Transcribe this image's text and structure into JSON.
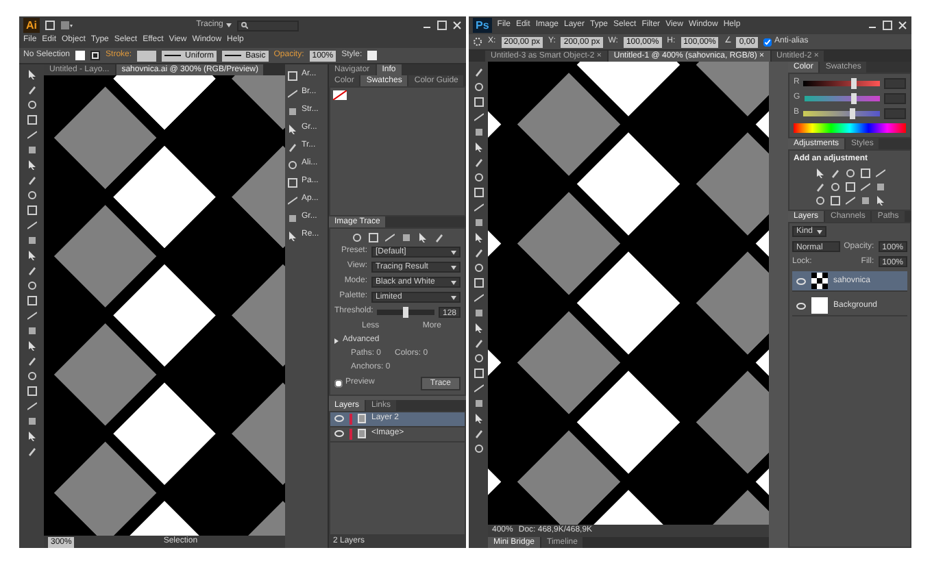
{
  "illustrator": {
    "logo": "Ai",
    "workspace": "Tracing",
    "menu": [
      "File",
      "Edit",
      "Object",
      "Type",
      "Select",
      "Effect",
      "View",
      "Window",
      "Help"
    ],
    "control_bar": {
      "selection": "No Selection",
      "stroke_label": "Stroke:",
      "stroke_profile": "Uniform",
      "brush": "Basic",
      "opacity_label": "Opacity:",
      "opacity": "100%",
      "style_label": "Style:"
    },
    "tabs": [
      {
        "label": "Untitled - Layo...",
        "selected": false
      },
      {
        "label": "sahovnica.ai @ 300% (RGB/Preview)",
        "selected": true
      }
    ],
    "dock": [
      "Ar...",
      "Br...",
      "Str...",
      "Gr...",
      "Tr...",
      "Ali...",
      "Pa...",
      "Ap...",
      "Gr...",
      "Re..."
    ],
    "info_panel": {
      "tabs": [
        {
          "label": "Navigator",
          "selected": false
        },
        {
          "label": "Info",
          "selected": true
        }
      ]
    },
    "swatches_panel": {
      "tabs": [
        {
          "label": "Color",
          "selected": false
        },
        {
          "label": "Swatches",
          "selected": true
        },
        {
          "label": "Color Guide",
          "selected": false
        }
      ]
    },
    "image_trace": {
      "title": "Image Trace",
      "fields": [
        {
          "label": "Preset:",
          "value": "[Default]"
        },
        {
          "label": "View:",
          "value": "Tracing Result"
        },
        {
          "label": "Mode:",
          "value": "Black and White"
        },
        {
          "label": "Palette:",
          "value": "Limited"
        }
      ],
      "threshold": {
        "label": "Threshold:",
        "level": 0.5,
        "value": "128",
        "less": "Less",
        "more": "More"
      },
      "advanced": "Advanced",
      "stats": [
        {
          "label": "Paths:",
          "value": "0"
        },
        {
          "label": "Colors:",
          "value": "0"
        },
        {
          "label": "Anchors:",
          "value": "0"
        }
      ],
      "preview": {
        "label": "Preview",
        "checked": false
      },
      "trace_button": "Trace"
    },
    "layers_panel": {
      "tabs": [
        {
          "label": "Layers",
          "selected": true
        },
        {
          "label": "Links",
          "selected": false
        }
      ],
      "layers": [
        {
          "name": "Layer 2",
          "selected": true
        },
        {
          "name": "<Image>",
          "selected": false
        }
      ],
      "count": "2 Layers"
    },
    "status_bar": {
      "zoom": "300%",
      "tool": "Selection"
    }
  },
  "photoshop": {
    "logo": "Ps",
    "menu": [
      "File",
      "Edit",
      "Image",
      "Layer",
      "Type",
      "Select",
      "Filter",
      "View",
      "Window",
      "Help"
    ],
    "options": [
      {
        "label": "X:",
        "value": "200,00 px"
      },
      {
        "label": "Y:",
        "value": "200,00 px"
      },
      {
        "label": "W:",
        "value": "100,00%"
      },
      {
        "label": "H:",
        "value": "100,00%"
      },
      {
        "label": "∠",
        "value": "0,00"
      }
    ],
    "anti_alias": {
      "label": "Anti-alias",
      "checked": true
    },
    "tabs": [
      {
        "label": "Untitled-3 as Smart Object-2 ×",
        "selected": false
      },
      {
        "label": "Untitled-1 @ 400% (sahovnica, RGB/8) ×",
        "selected": true
      },
      {
        "label": "Untitled-2 ×",
        "selected": false
      }
    ],
    "color_panel": {
      "tabs": [
        {
          "label": "Color",
          "selected": true
        },
        {
          "label": "Swatches",
          "selected": false
        }
      ],
      "sliders": [
        {
          "label": "R",
          "level": 0.65
        },
        {
          "label": "G",
          "level": 0.65
        },
        {
          "label": "B",
          "level": 0.65
        }
      ]
    },
    "adjustments_panel": {
      "tabs": [
        {
          "label": "Adjustments",
          "selected": true
        },
        {
          "label": "Styles",
          "selected": false
        }
      ],
      "heading": "Add an adjustment"
    },
    "layers_panel": {
      "tabs": [
        {
          "label": "Layers",
          "selected": true
        },
        {
          "label": "Channels",
          "selected": false
        },
        {
          "label": "Paths",
          "selected": false
        }
      ],
      "kind": "Kind",
      "blend_mode": "Normal",
      "opacity_label": "Opacity:",
      "opacity": "100%",
      "lock_label": "Lock:",
      "fill_label": "Fill:",
      "fill": "100%",
      "layers": [
        {
          "name": "sahovnica",
          "selected": true,
          "kind": "pattern"
        },
        {
          "name": "Background",
          "selected": false,
          "kind": "white"
        }
      ]
    },
    "status_bar": {
      "zoom": "400%",
      "doc": "Doc: 468,9K/468,9K"
    },
    "bottom_tabs": [
      {
        "label": "Mini Bridge",
        "selected": true
      },
      {
        "label": "Timeline",
        "selected": false
      }
    ]
  }
}
